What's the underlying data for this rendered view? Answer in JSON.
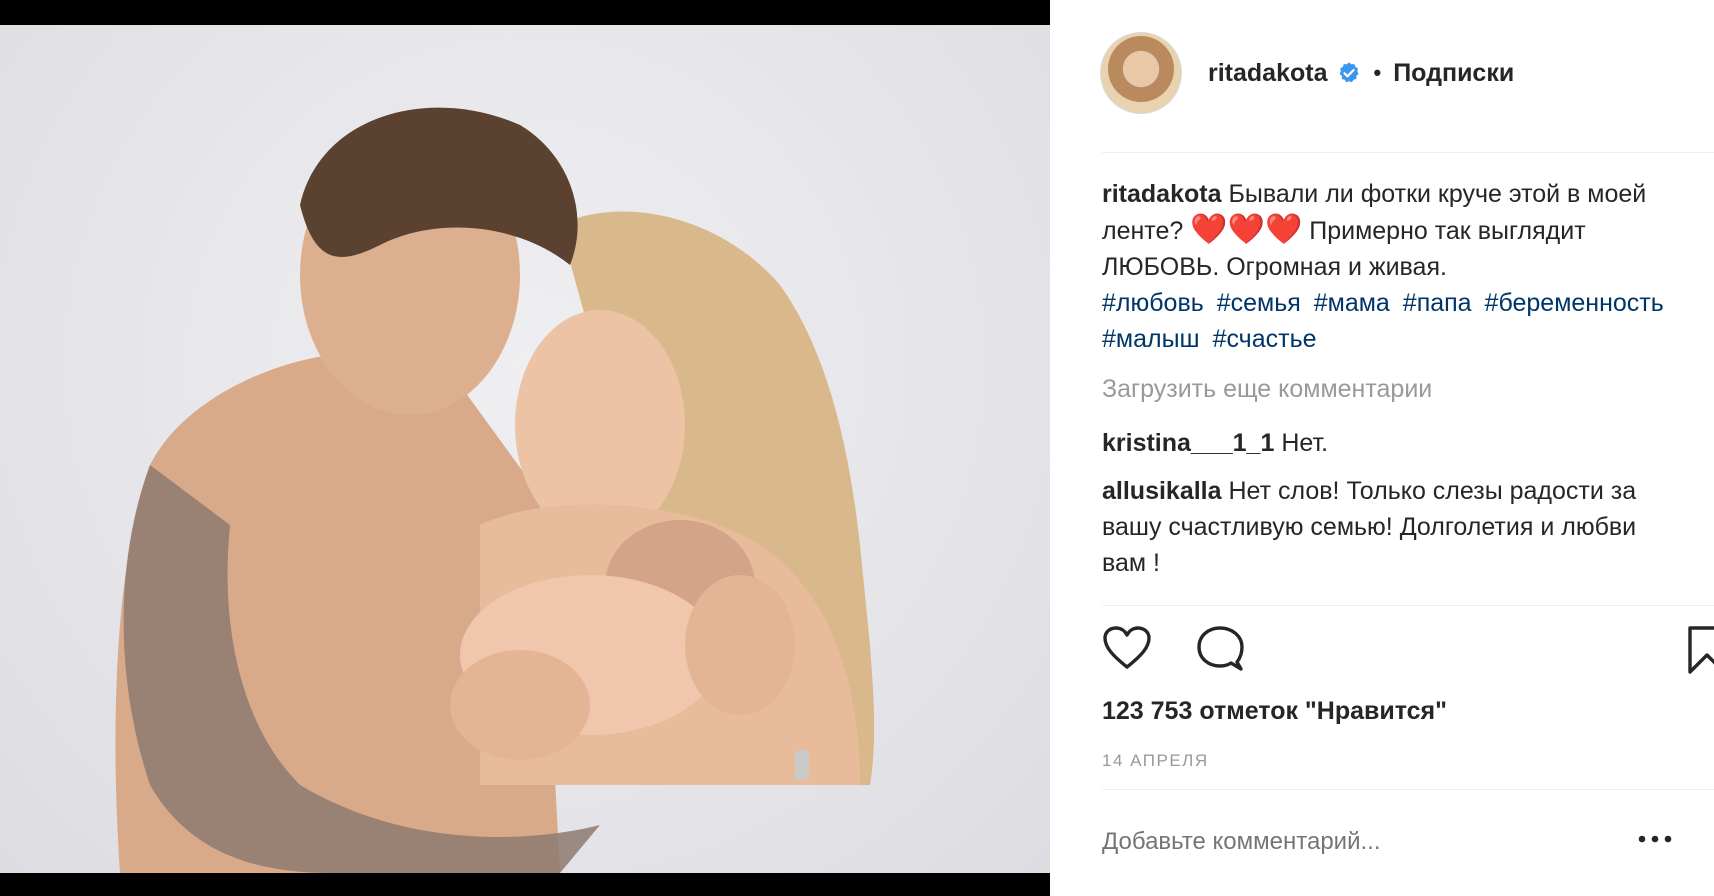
{
  "post": {
    "username": "ritadakota",
    "separator": "•",
    "follow_label": "Подписки",
    "caption_user": "ritadakota",
    "caption_text_1": "Бывали ли фотки круче этой в моей ленте?",
    "hearts": "❤️❤️❤️",
    "caption_text_2": "Примерно так выглядит ЛЮБОВЬ. Огромная и живая.",
    "hashtags": [
      "#любовь",
      "#семья",
      "#мама",
      "#папа",
      "#беременность",
      "#малыш",
      "#счастье"
    ],
    "load_more": "Загрузить еще комментарии",
    "comments": [
      {
        "user": "kristina___1_1",
        "text": "Нет."
      },
      {
        "user": "allusikalla",
        "text": "Нет слов! Только слезы радости за вашу счастливую семью! Долголетия и любви вам !"
      }
    ],
    "likes": "123 753 отметок \"Нравится\"",
    "date": "14 АПРЕЛЯ",
    "add_comment_placeholder": "Добавьте комментарий..."
  },
  "icons": {
    "verified": "verified-badge-icon",
    "like": "heart-icon",
    "comment": "comment-bubble-icon",
    "save": "bookmark-icon",
    "more": "more-options-icon"
  },
  "colors": {
    "hashtag": "#003569",
    "verified": "#3897f0",
    "muted": "#999999",
    "heart": "#e0182e"
  }
}
